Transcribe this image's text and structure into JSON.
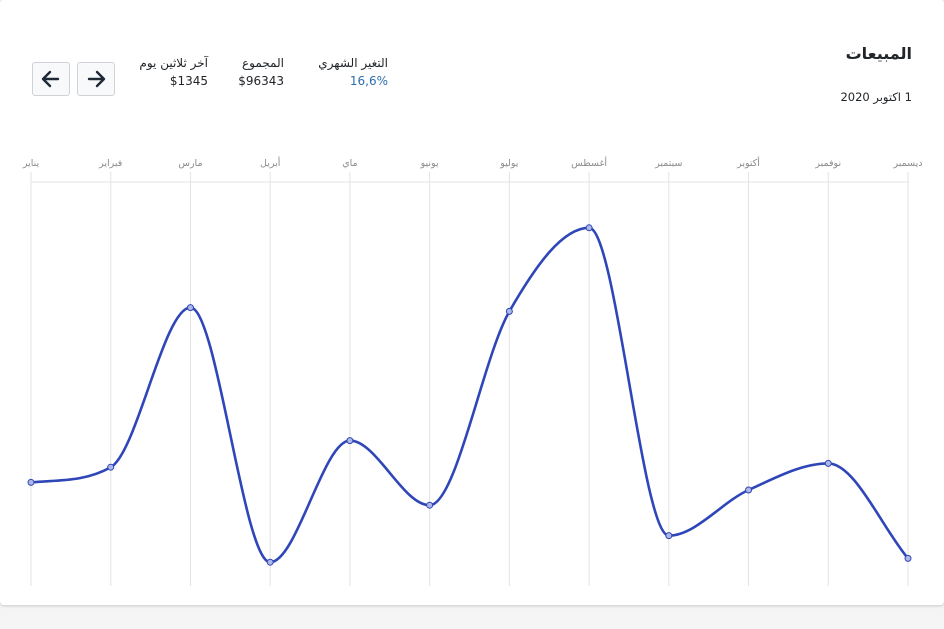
{
  "header": {
    "title": "المبيعات",
    "date": "1 اكتوبر 2020"
  },
  "stats": {
    "monthly_change_label": "التغير الشهري",
    "monthly_change_value": "16,6%",
    "total_label": "المجموع",
    "total_value": "$96343",
    "last30_label": "آخر ثلاثين يوم",
    "last30_value": "$1345"
  },
  "nav": {
    "prev_icon": "arrow-left-icon",
    "next_icon": "arrow-right-icon"
  },
  "colors": {
    "line": "#2f46b8",
    "grid": "#e3e3e3",
    "accent": "#2c6eab"
  },
  "chart_data": {
    "type": "line",
    "smooth": true,
    "categories": [
      "يناير",
      "فبراير",
      "مارس",
      "أبريل",
      "ماي",
      "يونيو",
      "يوليو",
      "أغسطس",
      "سبتمبر",
      "أكتوبر",
      "نوفمبر",
      "ديسمبر"
    ],
    "values": [
      27,
      31,
      73,
      6,
      38,
      21,
      72,
      94,
      13,
      25,
      32,
      7
    ],
    "ylim": [
      0,
      100
    ],
    "grid": "vertical",
    "legend": "none"
  }
}
